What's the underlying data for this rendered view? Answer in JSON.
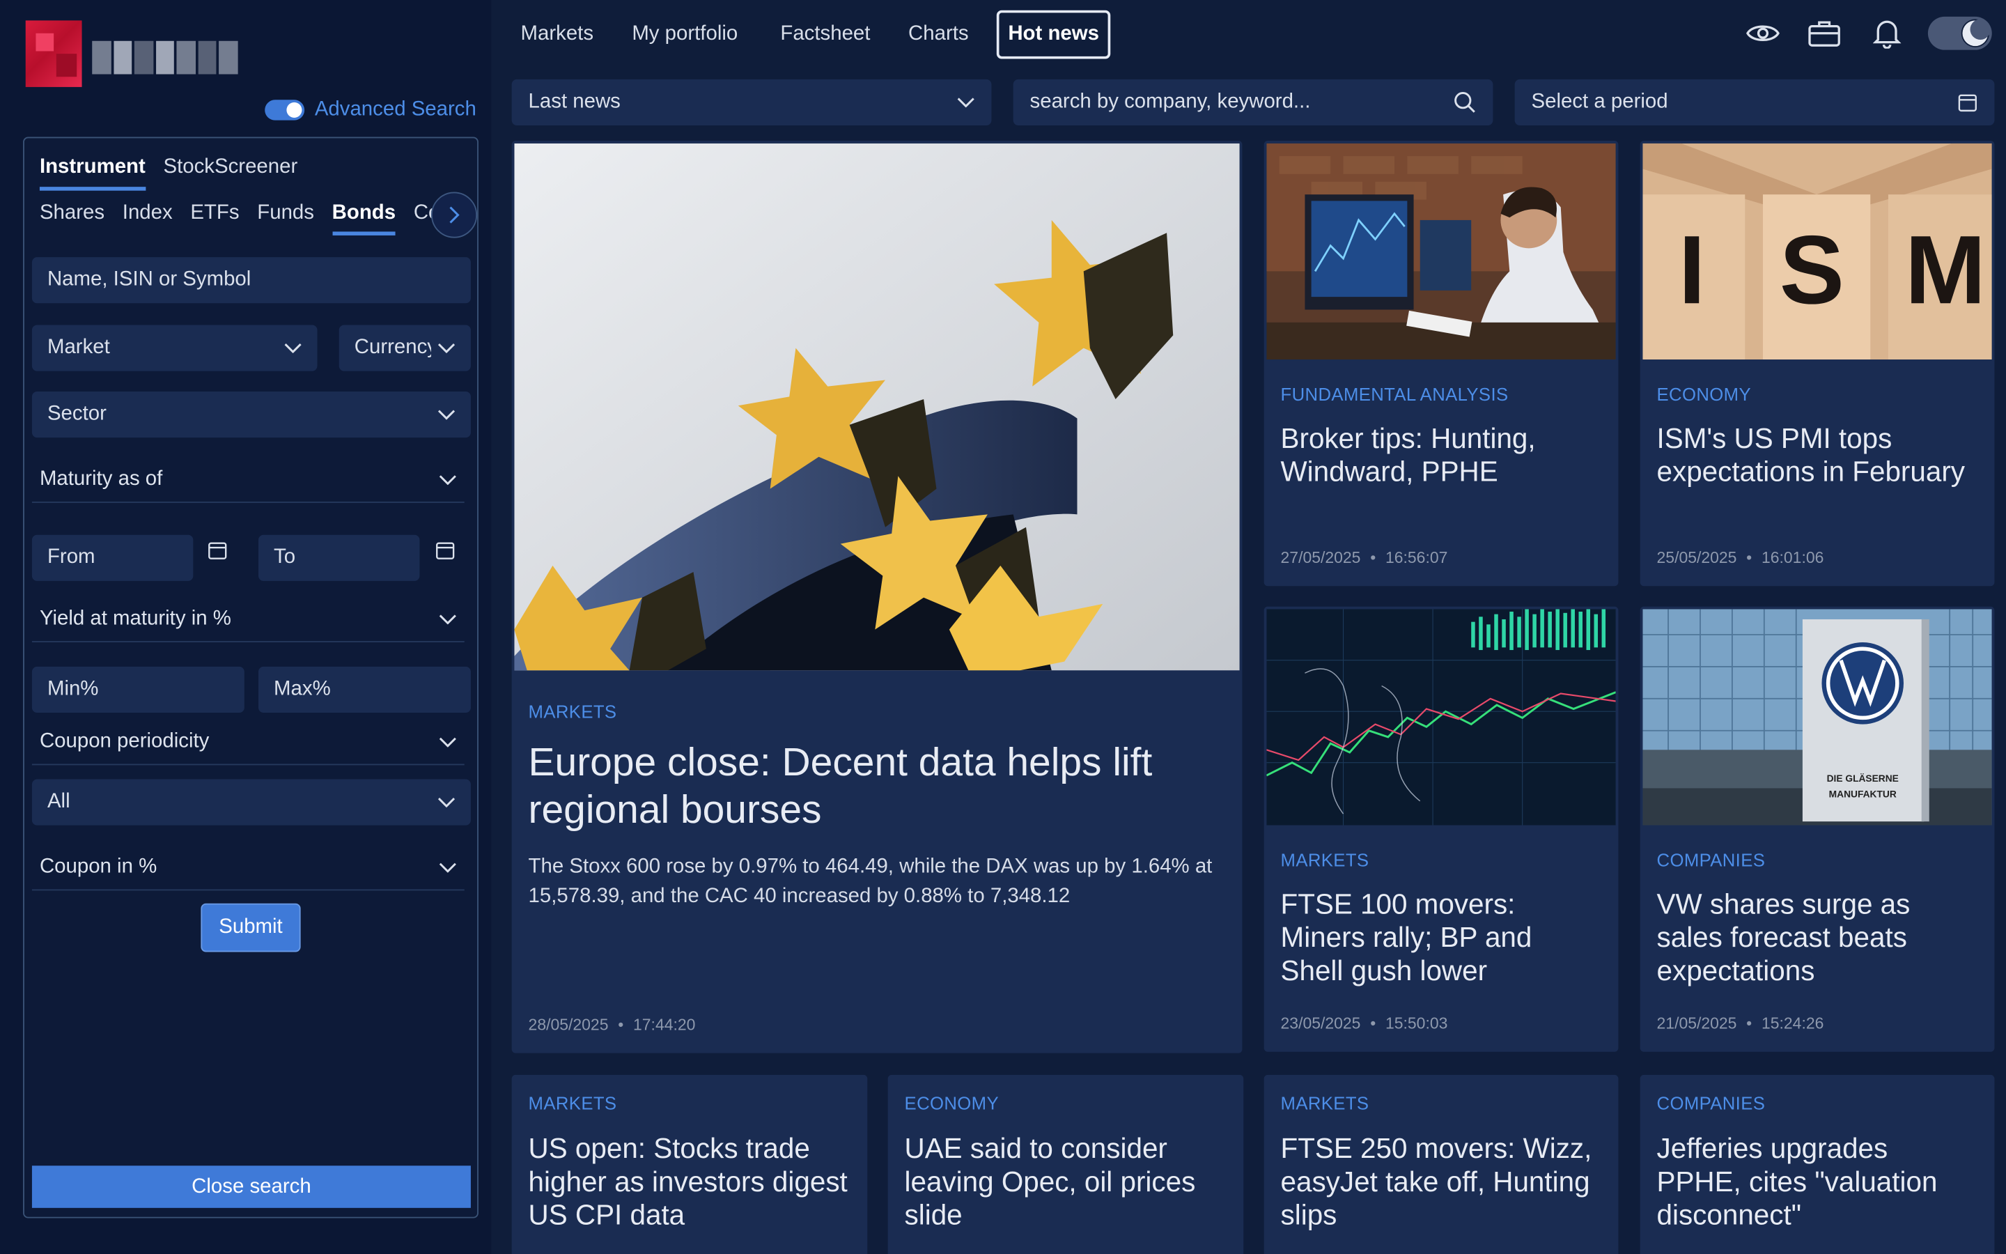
{
  "sidebar": {
    "advanced_search_label": "Advanced Search",
    "panel_tabs": [
      "Instrument",
      "StockScreener"
    ],
    "asset_tabs": [
      "Shares",
      "Index",
      "ETFs",
      "Funds",
      "Bonds",
      "Certificates"
    ],
    "active_asset_tab": "Bonds",
    "name_placeholder": "Name, ISIN or Symbol",
    "market_label": "Market",
    "currency_label": "Currency",
    "sector_label": "Sector",
    "maturity_label": "Maturity as of",
    "from_label": "From",
    "to_label": "To",
    "yield_label": "Yield at maturity in %",
    "min_label": "Min%",
    "max_label": "Max%",
    "coupon_periodicity_label": "Coupon periodicity",
    "coupon_periodicity_value": "All",
    "coupon_label": "Coupon in %",
    "submit_label": "Submit",
    "close_search_label": "Close search"
  },
  "nav": {
    "items": [
      "Markets",
      "My portfolio",
      "Factsheet",
      "Charts",
      "Hot news"
    ],
    "active": "Hot news"
  },
  "filters": {
    "news_type": "Last news",
    "search_placeholder": "search by company, keyword...",
    "period_placeholder": "Select a period"
  },
  "articles": {
    "featured": {
      "category": "MARKETS",
      "title": "Europe close: Decent data helps lift regional bourses",
      "summary": "The Stoxx 600 rose by 0.97% to 464.49, while the DAX was up by 1.64% at 15,578.39, and the CAC 40 increased by 0.88% to 7,348.12",
      "date": "28/05/2025",
      "time": "17:44:20"
    },
    "a1": {
      "category": "FUNDAMENTAL ANALYSIS",
      "title": "Broker tips: Hunting, Windward, PPHE",
      "date": "27/05/2025",
      "time": "16:56:07"
    },
    "a2": {
      "category": "ECONOMY",
      "title": "ISM's US PMI tops expectations in February",
      "date": "25/05/2025",
      "time": "16:01:06",
      "image_text": "ISM"
    },
    "a3": {
      "category": "MARKETS",
      "title": "FTSE 100 movers: Miners rally; BP and Shell gush lower",
      "date": "23/05/2025",
      "time": "15:50:03"
    },
    "a4": {
      "category": "COMPANIES",
      "title": "VW shares surge as sales forecast beats expectations",
      "date": "21/05/2025",
      "time": "15:24:26",
      "image_text_1": "DIE GLÄSERNE",
      "image_text_2": "MANUFAKTUR"
    },
    "a5": {
      "category": "MARKETS",
      "title": "US open: Stocks trade higher as investors digest US CPI data"
    },
    "a6": {
      "category": "ECONOMY",
      "title": "UAE said to consider leaving Opec, oil prices slide"
    },
    "a7": {
      "category": "MARKETS",
      "title": "FTSE 250 movers: Wizz, easyJet take off, Hunting slips"
    },
    "a8": {
      "category": "COMPANIES",
      "title": "Jefferies upgrades PPHE, cites \"valuation disconnect\""
    }
  },
  "separator": "•",
  "colors": {
    "background": "#0f1d3a",
    "card": "#1a2c52",
    "accent": "#3f7ad8",
    "category": "#4d8ee8"
  }
}
